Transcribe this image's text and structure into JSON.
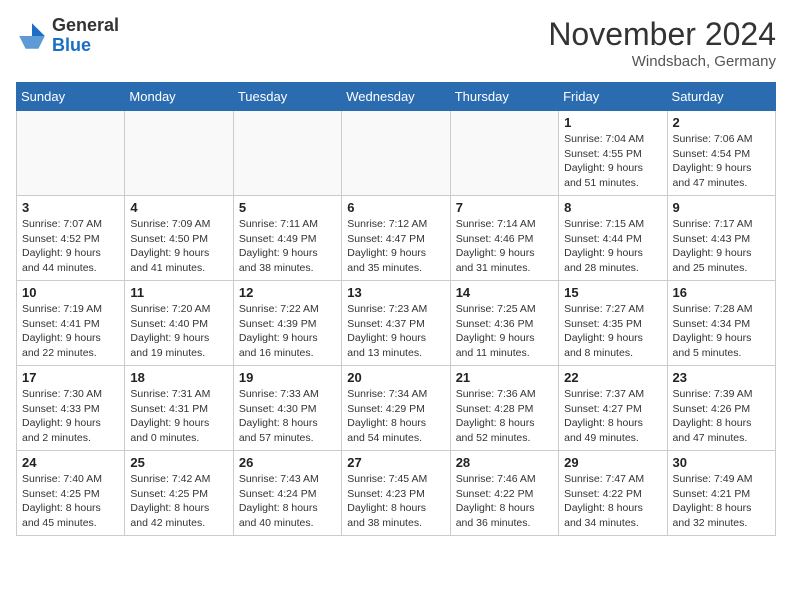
{
  "header": {
    "logo_general": "General",
    "logo_blue": "Blue",
    "month": "November 2024",
    "location": "Windsbach, Germany"
  },
  "weekdays": [
    "Sunday",
    "Monday",
    "Tuesday",
    "Wednesday",
    "Thursday",
    "Friday",
    "Saturday"
  ],
  "weeks": [
    [
      {
        "day": "",
        "info": ""
      },
      {
        "day": "",
        "info": ""
      },
      {
        "day": "",
        "info": ""
      },
      {
        "day": "",
        "info": ""
      },
      {
        "day": "",
        "info": ""
      },
      {
        "day": "1",
        "info": "Sunrise: 7:04 AM\nSunset: 4:55 PM\nDaylight: 9 hours\nand 51 minutes."
      },
      {
        "day": "2",
        "info": "Sunrise: 7:06 AM\nSunset: 4:54 PM\nDaylight: 9 hours\nand 47 minutes."
      }
    ],
    [
      {
        "day": "3",
        "info": "Sunrise: 7:07 AM\nSunset: 4:52 PM\nDaylight: 9 hours\nand 44 minutes."
      },
      {
        "day": "4",
        "info": "Sunrise: 7:09 AM\nSunset: 4:50 PM\nDaylight: 9 hours\nand 41 minutes."
      },
      {
        "day": "5",
        "info": "Sunrise: 7:11 AM\nSunset: 4:49 PM\nDaylight: 9 hours\nand 38 minutes."
      },
      {
        "day": "6",
        "info": "Sunrise: 7:12 AM\nSunset: 4:47 PM\nDaylight: 9 hours\nand 35 minutes."
      },
      {
        "day": "7",
        "info": "Sunrise: 7:14 AM\nSunset: 4:46 PM\nDaylight: 9 hours\nand 31 minutes."
      },
      {
        "day": "8",
        "info": "Sunrise: 7:15 AM\nSunset: 4:44 PM\nDaylight: 9 hours\nand 28 minutes."
      },
      {
        "day": "9",
        "info": "Sunrise: 7:17 AM\nSunset: 4:43 PM\nDaylight: 9 hours\nand 25 minutes."
      }
    ],
    [
      {
        "day": "10",
        "info": "Sunrise: 7:19 AM\nSunset: 4:41 PM\nDaylight: 9 hours\nand 22 minutes."
      },
      {
        "day": "11",
        "info": "Sunrise: 7:20 AM\nSunset: 4:40 PM\nDaylight: 9 hours\nand 19 minutes."
      },
      {
        "day": "12",
        "info": "Sunrise: 7:22 AM\nSunset: 4:39 PM\nDaylight: 9 hours\nand 16 minutes."
      },
      {
        "day": "13",
        "info": "Sunrise: 7:23 AM\nSunset: 4:37 PM\nDaylight: 9 hours\nand 13 minutes."
      },
      {
        "day": "14",
        "info": "Sunrise: 7:25 AM\nSunset: 4:36 PM\nDaylight: 9 hours\nand 11 minutes."
      },
      {
        "day": "15",
        "info": "Sunrise: 7:27 AM\nSunset: 4:35 PM\nDaylight: 9 hours\nand 8 minutes."
      },
      {
        "day": "16",
        "info": "Sunrise: 7:28 AM\nSunset: 4:34 PM\nDaylight: 9 hours\nand 5 minutes."
      }
    ],
    [
      {
        "day": "17",
        "info": "Sunrise: 7:30 AM\nSunset: 4:33 PM\nDaylight: 9 hours\nand 2 minutes."
      },
      {
        "day": "18",
        "info": "Sunrise: 7:31 AM\nSunset: 4:31 PM\nDaylight: 9 hours\nand 0 minutes."
      },
      {
        "day": "19",
        "info": "Sunrise: 7:33 AM\nSunset: 4:30 PM\nDaylight: 8 hours\nand 57 minutes."
      },
      {
        "day": "20",
        "info": "Sunrise: 7:34 AM\nSunset: 4:29 PM\nDaylight: 8 hours\nand 54 minutes."
      },
      {
        "day": "21",
        "info": "Sunrise: 7:36 AM\nSunset: 4:28 PM\nDaylight: 8 hours\nand 52 minutes."
      },
      {
        "day": "22",
        "info": "Sunrise: 7:37 AM\nSunset: 4:27 PM\nDaylight: 8 hours\nand 49 minutes."
      },
      {
        "day": "23",
        "info": "Sunrise: 7:39 AM\nSunset: 4:26 PM\nDaylight: 8 hours\nand 47 minutes."
      }
    ],
    [
      {
        "day": "24",
        "info": "Sunrise: 7:40 AM\nSunset: 4:25 PM\nDaylight: 8 hours\nand 45 minutes."
      },
      {
        "day": "25",
        "info": "Sunrise: 7:42 AM\nSunset: 4:25 PM\nDaylight: 8 hours\nand 42 minutes."
      },
      {
        "day": "26",
        "info": "Sunrise: 7:43 AM\nSunset: 4:24 PM\nDaylight: 8 hours\nand 40 minutes."
      },
      {
        "day": "27",
        "info": "Sunrise: 7:45 AM\nSunset: 4:23 PM\nDaylight: 8 hours\nand 38 minutes."
      },
      {
        "day": "28",
        "info": "Sunrise: 7:46 AM\nSunset: 4:22 PM\nDaylight: 8 hours\nand 36 minutes."
      },
      {
        "day": "29",
        "info": "Sunrise: 7:47 AM\nSunset: 4:22 PM\nDaylight: 8 hours\nand 34 minutes."
      },
      {
        "day": "30",
        "info": "Sunrise: 7:49 AM\nSunset: 4:21 PM\nDaylight: 8 hours\nand 32 minutes."
      }
    ]
  ]
}
